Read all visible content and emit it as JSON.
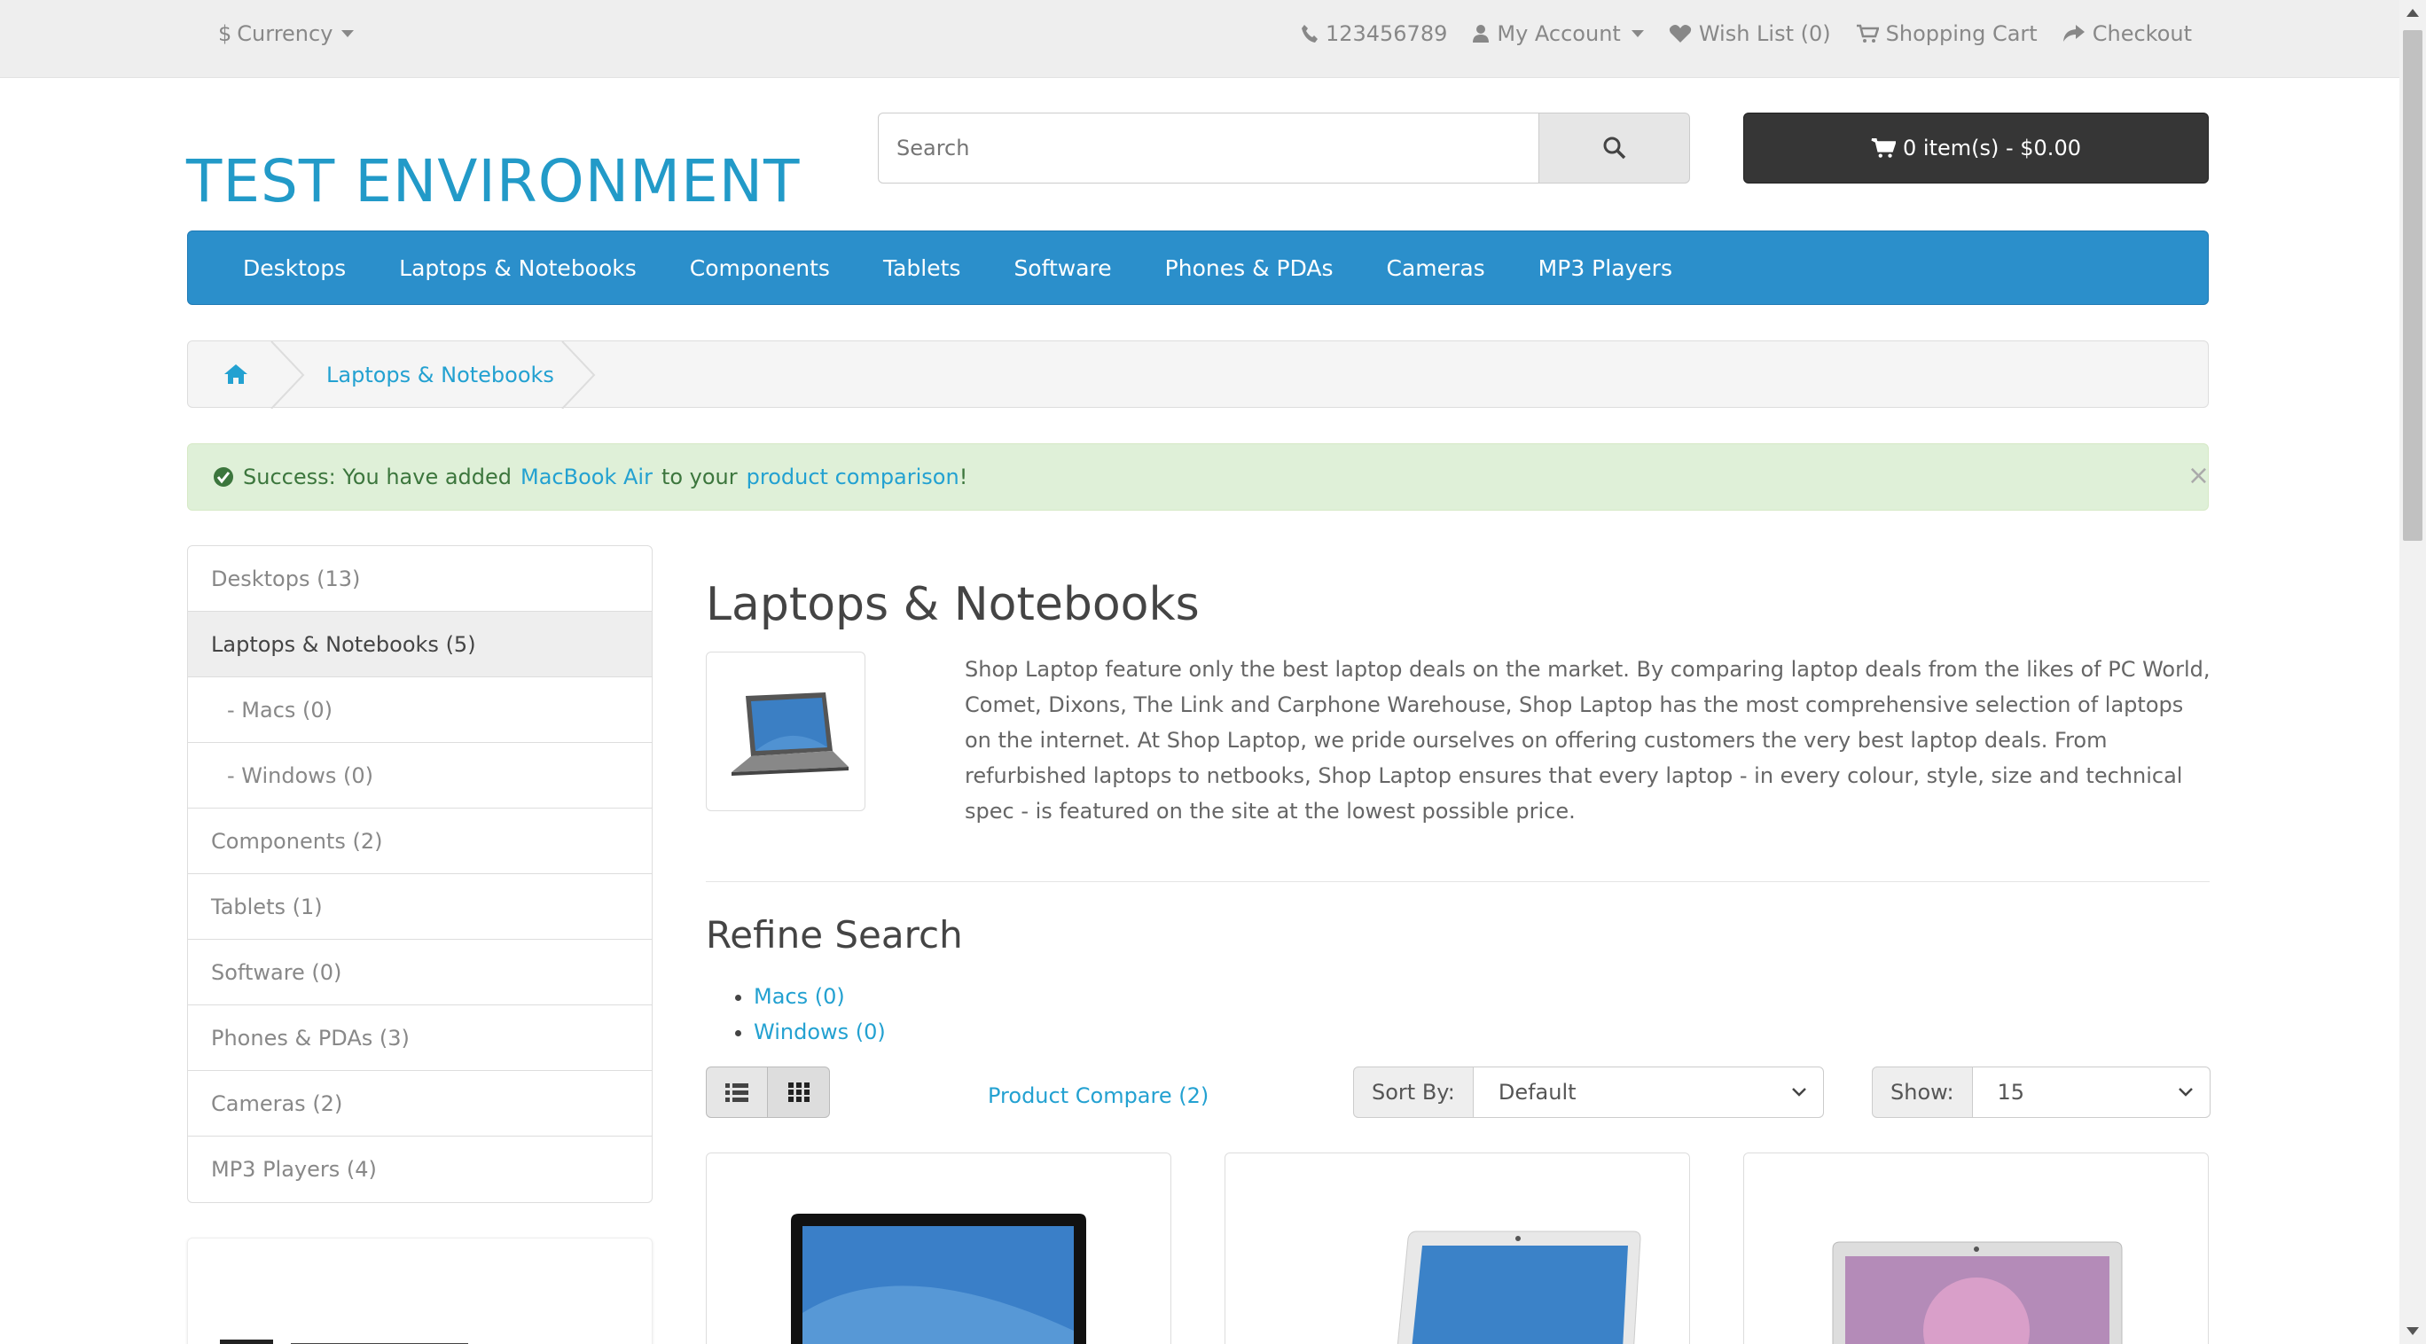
{
  "topbar": {
    "currency_label": "Currency",
    "phone": "123456789",
    "my_account": "My Account",
    "wish_list": "Wish List (0)",
    "shopping_cart": "Shopping Cart",
    "checkout": "Checkout"
  },
  "header": {
    "logo": "TEST ENVIRONMENT",
    "search_placeholder": "Search",
    "cart_button": "0 item(s) - $0.00"
  },
  "menu": {
    "items": [
      "Desktops",
      "Laptops & Notebooks",
      "Components",
      "Tablets",
      "Software",
      "Phones & PDAs",
      "Cameras",
      "MP3 Players"
    ]
  },
  "breadcrumb": {
    "current": "Laptops & Notebooks"
  },
  "alert": {
    "prefix": "Success: You have added",
    "product_link": "MacBook Air",
    "middle": "to your",
    "comparison_link": "product comparison",
    "suffix": "!",
    "close": "×"
  },
  "sidebar": {
    "items": [
      {
        "label": "Desktops (13)"
      },
      {
        "label": "Laptops & Notebooks (5)"
      },
      {
        "label": "- Macs (0)"
      },
      {
        "label": "- Windows (0)"
      },
      {
        "label": "Components (2)"
      },
      {
        "label": "Tablets (1)"
      },
      {
        "label": "Software (0)"
      },
      {
        "label": "Phones & PDAs (3)"
      },
      {
        "label": "Cameras (2)"
      },
      {
        "label": "MP3 Players (4)"
      }
    ]
  },
  "content": {
    "title": "Laptops & Notebooks",
    "description": "Shop Laptop feature only the best laptop deals on the market. By comparing laptop deals from the likes of PC World, Comet, Dixons, The Link and Carphone Warehouse, Shop Laptop has the most comprehensive selection of laptops on the internet. At Shop Laptop, we pride ourselves on offering customers the very best laptop deals. From refurbished laptops to netbooks, Shop Laptop ensures that every laptop - in every colour, style, size and technical spec - is featured on the site at the lowest possible price.",
    "refine_title": "Refine Search",
    "refine_links": [
      "Macs (0)",
      "Windows (0)"
    ],
    "product_compare": "Product Compare (2)",
    "sort_label": "Sort By:",
    "sort_value": "Default",
    "show_label": "Show:",
    "show_value": "15"
  },
  "colors": {
    "brand": "#229ac8",
    "menu_bg": "#2b8fcb",
    "alert_bg": "#dff0d8",
    "link": "#23a1d1"
  }
}
